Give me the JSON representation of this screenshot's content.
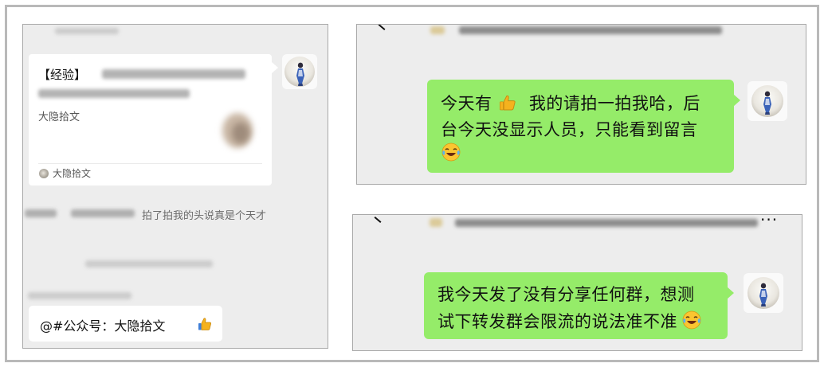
{
  "left_panel": {
    "card": {
      "title_prefix": "【经验】",
      "source": "大隐拾文",
      "footer": "大隐拾文"
    },
    "pat_text": "拍了拍我的头说真是个天才",
    "quote": {
      "text": "@#公众号：大隐拾文",
      "emoji": "thumbs-up-icon"
    }
  },
  "top_right": {
    "message_lines": [
      "今天有",
      "我的请拍一拍我哈，后",
      "台今天没显示人员，只能看到留言"
    ],
    "emojis": [
      "thumbs-up-icon",
      "laughing-tears-icon"
    ]
  },
  "bottom_right": {
    "message_lines": [
      "我今天发了没有分享任何群，想测",
      "试下转发群会限流的说法准不准"
    ],
    "emojis": [
      "laughing-tears-icon"
    ],
    "menu": "···"
  },
  "colors": {
    "chat_background": "#ededed",
    "sent_bubble": "#95ec69",
    "card_background": "#ffffff",
    "frame_border": "#b9b9b9"
  }
}
